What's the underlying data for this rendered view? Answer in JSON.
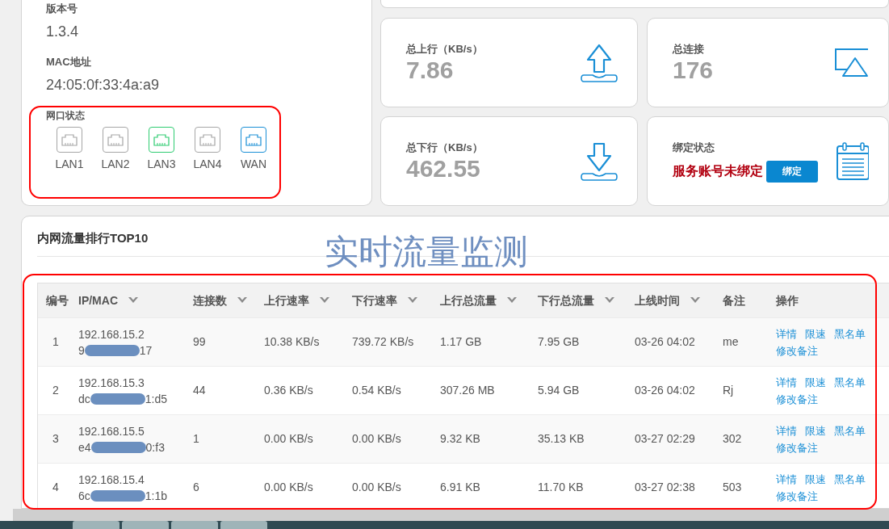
{
  "device": {
    "version_label": "版本号",
    "version": "1.3.4",
    "mac_label": "MAC地址",
    "mac": "24:05:0f:33:4a:a9",
    "ports_label": "网口状态",
    "ports": [
      {
        "name": "LAN1",
        "color": "#a6a6a6"
      },
      {
        "name": "LAN2",
        "color": "#a6a6a6"
      },
      {
        "name": "LAN3",
        "color": "#2ecc71"
      },
      {
        "name": "LAN4",
        "color": "#a6a6a6"
      },
      {
        "name": "WAN",
        "color": "#1a8fd6"
      }
    ]
  },
  "stats": [
    {
      "kind": "upload",
      "label": "总上行（KB/s）",
      "value": "7.86"
    },
    {
      "kind": "connections",
      "label": "总连接",
      "value": "176"
    },
    {
      "kind": "download",
      "label": "总下行（KB/s）",
      "value": "462.55"
    },
    {
      "kind": "binding",
      "label": "绑定状态",
      "status": "服务账号未绑定",
      "button": "绑定"
    }
  ],
  "traffic": {
    "title": "内网流量排行TOP10",
    "columns": [
      {
        "label": "编号",
        "sortable": false
      },
      {
        "label": "IP/MAC",
        "sortable": true
      },
      {
        "label": "连接数",
        "sortable": true
      },
      {
        "label": "上行速率",
        "sortable": true
      },
      {
        "label": "下行速率",
        "sortable": true
      },
      {
        "label": "上行总流量",
        "sortable": true
      },
      {
        "label": "下行总流量",
        "sortable": true
      },
      {
        "label": "上线时间",
        "sortable": true
      },
      {
        "label": "备注",
        "sortable": false
      },
      {
        "label": "操作",
        "sortable": false
      }
    ],
    "rows": [
      {
        "no": "1",
        "ip": "192.168.15.2",
        "mac_start": "9",
        "mac_end": "17",
        "connections": "99",
        "up_rate": "10.38 KB/s",
        "down_rate": "739.72 KB/s",
        "up_total": "1.17 GB",
        "down_total": "7.95 GB",
        "online": "03-26 04:02",
        "note": "me",
        "actions": [
          "详情",
          "限速",
          "黑名单",
          "修改备注"
        ]
      },
      {
        "no": "2",
        "ip": "192.168.15.3",
        "mac_start": "dc",
        "mac_end": "1:d5",
        "connections": "44",
        "up_rate": "0.36 KB/s",
        "down_rate": "0.54 KB/s",
        "up_total": "307.26 MB",
        "down_total": "5.94 GB",
        "online": "03-26 04:02",
        "note": "Rj",
        "actions": [
          "详情",
          "限速",
          "黑名单",
          "修改备注"
        ]
      },
      {
        "no": "3",
        "ip": "192.168.15.5",
        "mac_start": "e4",
        "mac_end": "0:f3",
        "connections": "1",
        "up_rate": "0.00 KB/s",
        "down_rate": "0.00 KB/s",
        "up_total": "9.32 KB",
        "down_total": "35.13 KB",
        "online": "03-27 02:29",
        "note": "302",
        "actions": [
          "详情",
          "限速",
          "黑名单",
          "修改备注"
        ]
      },
      {
        "no": "4",
        "ip": "192.168.15.4",
        "mac_start": "6c",
        "mac_end": "1:1b",
        "connections": "6",
        "up_rate": "0.00 KB/s",
        "down_rate": "0.00 KB/s",
        "up_total": "6.91 KB",
        "down_total": "11.70 KB",
        "online": "03-27 02:38",
        "note": "503",
        "actions": [
          "详情",
          "限速",
          "黑名单",
          "修改备注"
        ]
      }
    ]
  },
  "annotation": {
    "title": "实时流量监测"
  }
}
